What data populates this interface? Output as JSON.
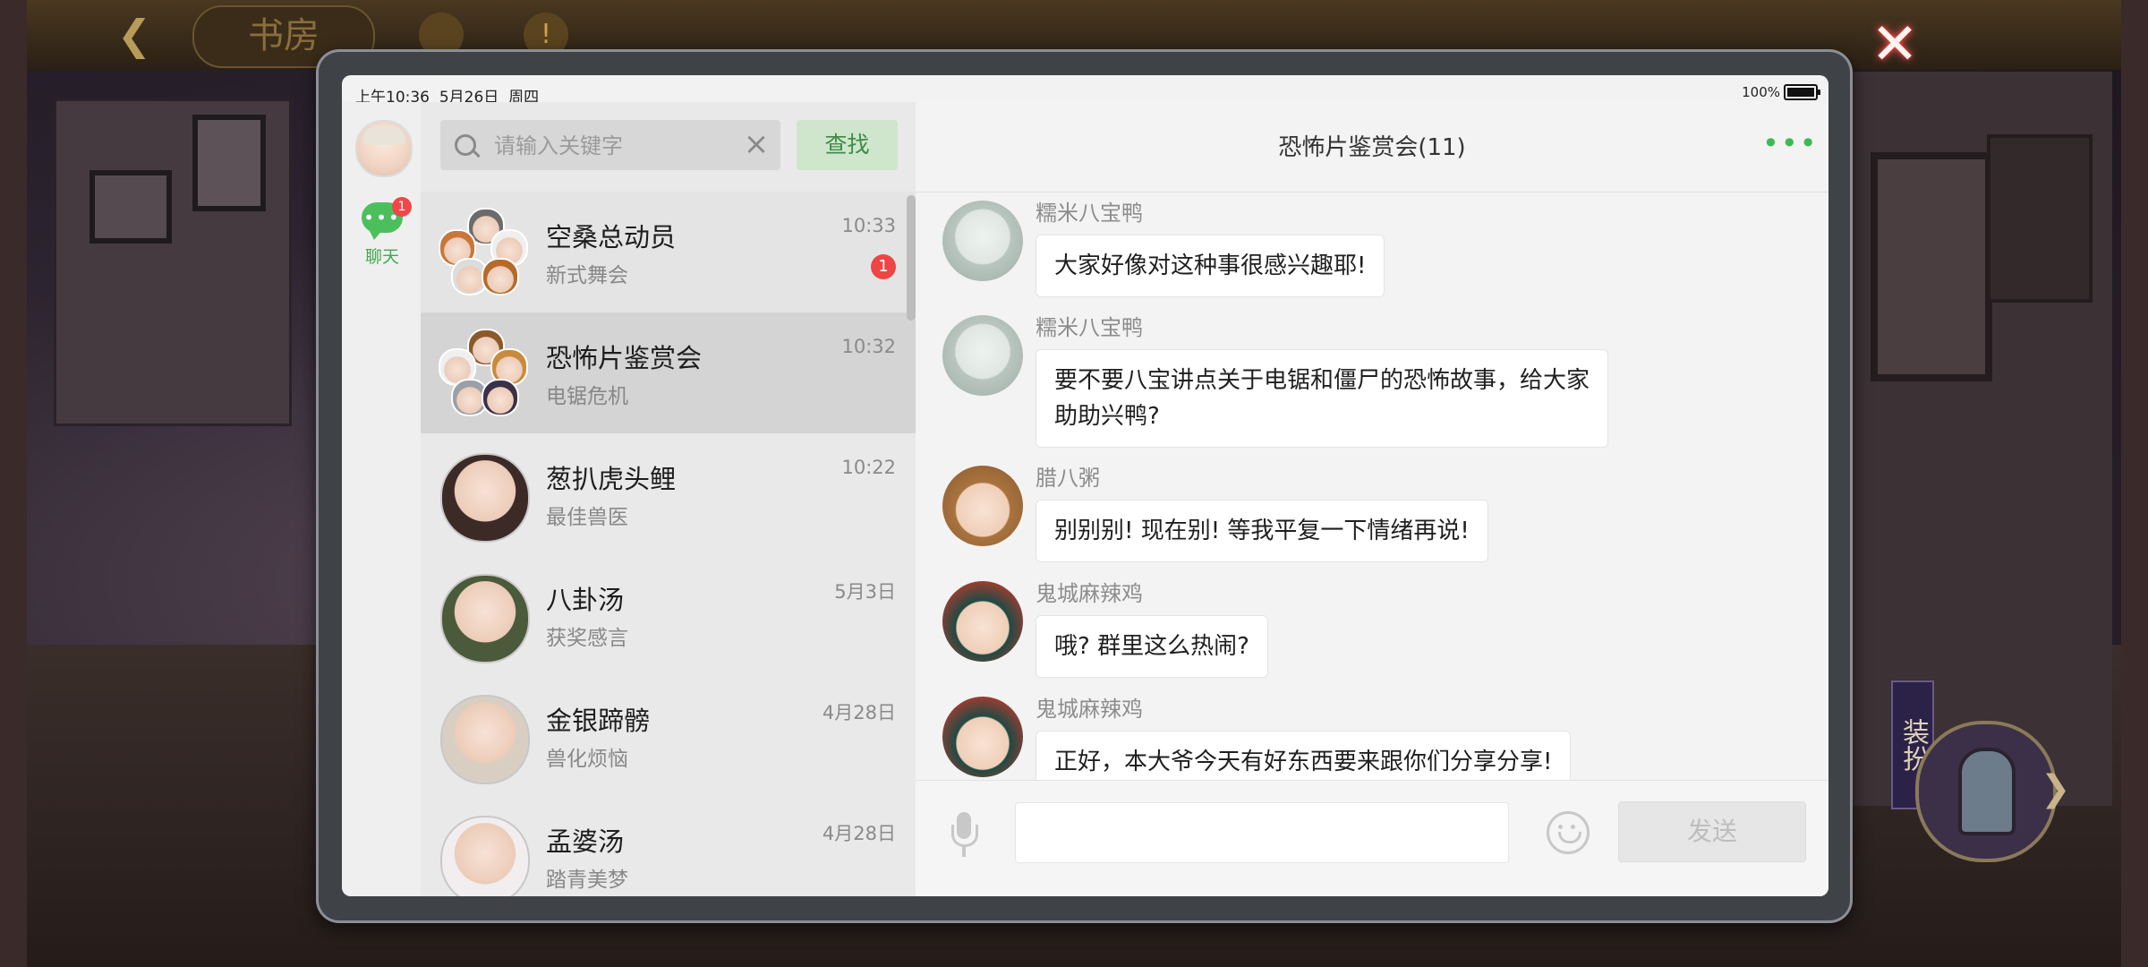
{
  "background": {
    "title_plate": "书房",
    "dress_up_label": "装扮"
  },
  "status_bar": {
    "time": "上午10:36",
    "date": "5月26日",
    "weekday": "周四",
    "battery": "100%"
  },
  "nav": {
    "chat_label": "聊天",
    "chat_badge": "1"
  },
  "search": {
    "placeholder": "请输入关键字",
    "button_label": "查找"
  },
  "conversations": [
    {
      "name": "空桑总动员",
      "preview": "新式舞会",
      "time": "10:33",
      "badge": "1"
    },
    {
      "name": "恐怖片鉴赏会",
      "preview": "电锯危机",
      "time": "10:32"
    },
    {
      "name": "葱扒虎头鲤",
      "preview": "最佳兽医",
      "time": "10:22"
    },
    {
      "name": "八卦汤",
      "preview": "获奖感言",
      "time": "5月3日"
    },
    {
      "name": "金银蹄髈",
      "preview": "兽化烦恼",
      "time": "4月28日"
    },
    {
      "name": "孟婆汤",
      "preview": "踏青美梦",
      "time": "4月28日"
    }
  ],
  "chat": {
    "title": "恐怖片鉴赏会(11)",
    "messages": [
      {
        "sender": "糯米八宝鸭",
        "text": "大家好像对这种事很感兴趣耶!"
      },
      {
        "sender": "糯米八宝鸭",
        "text_lines": [
          "要不要八宝讲点关于电锯和僵尸的恐怖故事，给大家",
          "助助兴鸭?"
        ]
      },
      {
        "sender": "腊八粥",
        "text": "别别别!  现在别!  等我平复一下情绪再说!"
      },
      {
        "sender": "鬼城麻辣鸡",
        "text": "哦? 群里这么热闹?"
      },
      {
        "sender": "鬼城麻辣鸡",
        "text": "正好，本大爷今天有好东西要来跟你们分享分享!"
      }
    ]
  },
  "input_bar": {
    "send_label": "发送"
  },
  "colors": {
    "accent_green": "#3fba52",
    "badge_red": "#ef4545",
    "selected_row": "#d4d4d4"
  }
}
